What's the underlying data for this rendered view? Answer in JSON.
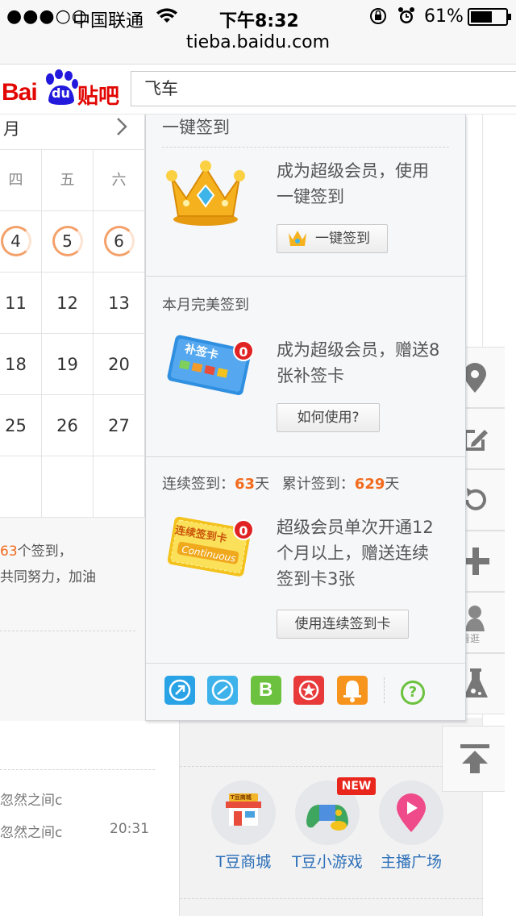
{
  "status_bar": {
    "signal_dots": "●●●○○",
    "carrier": "中国联通",
    "time": "下午8:32",
    "battery_pct": "61%",
    "battery_level": 0.61
  },
  "browser": {
    "url": "tieba.baidu.com"
  },
  "header": {
    "logo_text_bai": "Bai",
    "logo_text_du": "du",
    "logo_text_tieba": "贴吧",
    "search_value": "飞车"
  },
  "calendar": {
    "month_suffix": "月",
    "weekdays": [
      "四",
      "五",
      "六"
    ],
    "row1": [
      "4",
      "5",
      "6"
    ],
    "row2": [
      "11",
      "12",
      "13"
    ],
    "row3": [
      "18",
      "19",
      "20"
    ],
    "row4": [
      "25",
      "26",
      "27"
    ],
    "note_count": "63",
    "note_line1": "个签到，",
    "note_line2": "共同努力，加油"
  },
  "popup": {
    "onekey": {
      "title": "一键签到",
      "desc_line1": "成为超级会员，使用",
      "desc_line2": "一键签到",
      "button": "一键签到"
    },
    "perfect": {
      "title": "本月完美签到",
      "card_label": "补签卡",
      "badge": "0",
      "desc_line1": "成为超级会员，赠送8",
      "desc_line2": "张补签卡",
      "button": "如何使用?"
    },
    "continuous": {
      "label_continuous": "连续签到：",
      "continuous_days": "63",
      "label_total": "累计签到：",
      "total_days": "629",
      "day_unit": "天",
      "card_label": "连续签到卡",
      "card_sub": "Continuous",
      "badge": "0",
      "desc_line1": "超级会员单次开通12",
      "desc_line2": "个月以上，赠送连续",
      "desc_line3": "签到卡3张",
      "button": "使用连续签到卡"
    },
    "icons": {
      "bb_label": "B",
      "help": "?"
    }
  },
  "feed": {
    "rows": [
      {
        "author": "忽然之间c",
        "time": ""
      },
      {
        "author": "忽然之间c",
        "time": "20:31"
      }
    ]
  },
  "games": {
    "items": [
      {
        "label": "T豆商城",
        "badge": ""
      },
      {
        "label": "T豆小游戏",
        "badge": "NEW"
      },
      {
        "label": "主播广场",
        "badge": ""
      }
    ],
    "shop_sign": "T豆商城"
  },
  "sidebar": {
    "lookaround": "看逛"
  },
  "colors": {
    "accent_orange": "#f26b1d",
    "link_blue": "#2c6fb8",
    "badge_red": "#e02222",
    "baidu_red": "#e10602",
    "baidu_blue": "#2319dc"
  }
}
